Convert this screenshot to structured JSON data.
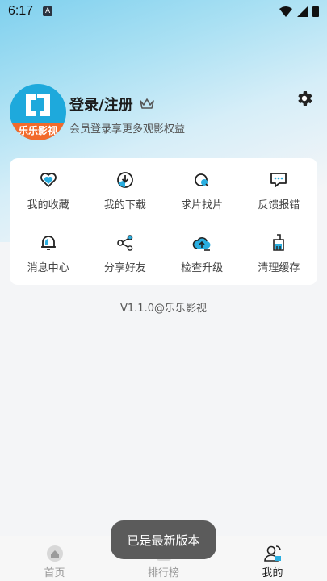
{
  "status_bar": {
    "time": "6:17",
    "notif_badge": "A"
  },
  "profile": {
    "avatar_text": "乐乐影视",
    "login_label": "登录/注册",
    "subtitle": "会员登录享更多观影权益"
  },
  "menu": {
    "items": [
      {
        "label": "我的收藏",
        "icon": "heart-icon"
      },
      {
        "label": "我的下载",
        "icon": "download-icon"
      },
      {
        "label": "求片找片",
        "icon": "film-search-icon"
      },
      {
        "label": "反馈报错",
        "icon": "feedback-icon"
      },
      {
        "label": "消息中心",
        "icon": "bell-icon"
      },
      {
        "label": "分享好友",
        "icon": "share-icon"
      },
      {
        "label": "检查升级",
        "icon": "cloud-upgrade-icon"
      },
      {
        "label": "清理缓存",
        "icon": "broom-icon"
      }
    ]
  },
  "version": "V1.1.0@乐乐影视",
  "tabbar": {
    "tabs": [
      {
        "label": "首页"
      },
      {
        "label": "排行榜"
      },
      {
        "label": "我的"
      }
    ]
  },
  "toast": "已是最新版本",
  "colors": {
    "accent": "#1ea9dc",
    "brand_orange": "#f26a2b"
  }
}
